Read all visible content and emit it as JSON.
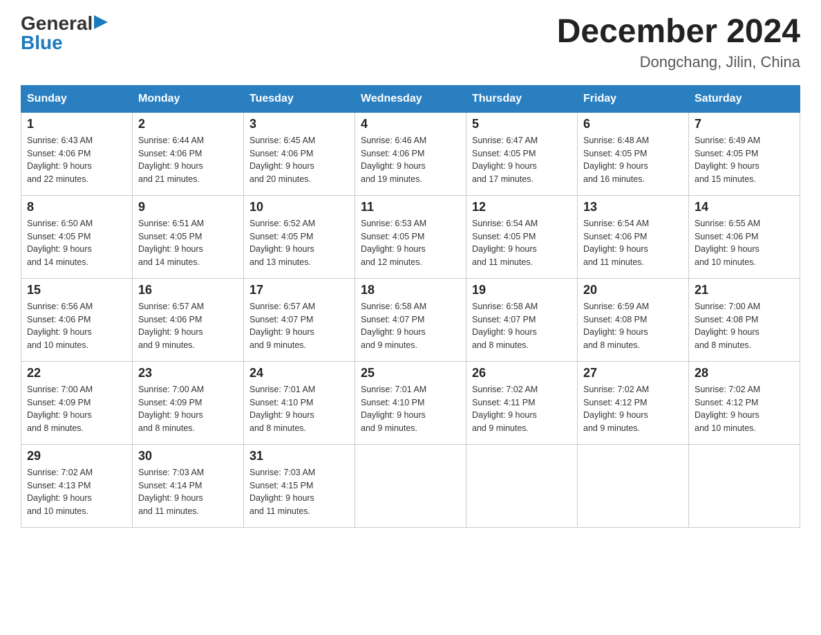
{
  "header": {
    "logo_general": "General",
    "logo_blue": "Blue",
    "title": "December 2024",
    "subtitle": "Dongchang, Jilin, China"
  },
  "days_of_week": [
    "Sunday",
    "Monday",
    "Tuesday",
    "Wednesday",
    "Thursday",
    "Friday",
    "Saturday"
  ],
  "weeks": [
    [
      {
        "day": "1",
        "sunrise": "6:43 AM",
        "sunset": "4:06 PM",
        "daylight": "9 hours and 22 minutes."
      },
      {
        "day": "2",
        "sunrise": "6:44 AM",
        "sunset": "4:06 PM",
        "daylight": "9 hours and 21 minutes."
      },
      {
        "day": "3",
        "sunrise": "6:45 AM",
        "sunset": "4:06 PM",
        "daylight": "9 hours and 20 minutes."
      },
      {
        "day": "4",
        "sunrise": "6:46 AM",
        "sunset": "4:06 PM",
        "daylight": "9 hours and 19 minutes."
      },
      {
        "day": "5",
        "sunrise": "6:47 AM",
        "sunset": "4:05 PM",
        "daylight": "9 hours and 17 minutes."
      },
      {
        "day": "6",
        "sunrise": "6:48 AM",
        "sunset": "4:05 PM",
        "daylight": "9 hours and 16 minutes."
      },
      {
        "day": "7",
        "sunrise": "6:49 AM",
        "sunset": "4:05 PM",
        "daylight": "9 hours and 15 minutes."
      }
    ],
    [
      {
        "day": "8",
        "sunrise": "6:50 AM",
        "sunset": "4:05 PM",
        "daylight": "9 hours and 14 minutes."
      },
      {
        "day": "9",
        "sunrise": "6:51 AM",
        "sunset": "4:05 PM",
        "daylight": "9 hours and 14 minutes."
      },
      {
        "day": "10",
        "sunrise": "6:52 AM",
        "sunset": "4:05 PM",
        "daylight": "9 hours and 13 minutes."
      },
      {
        "day": "11",
        "sunrise": "6:53 AM",
        "sunset": "4:05 PM",
        "daylight": "9 hours and 12 minutes."
      },
      {
        "day": "12",
        "sunrise": "6:54 AM",
        "sunset": "4:05 PM",
        "daylight": "9 hours and 11 minutes."
      },
      {
        "day": "13",
        "sunrise": "6:54 AM",
        "sunset": "4:06 PM",
        "daylight": "9 hours and 11 minutes."
      },
      {
        "day": "14",
        "sunrise": "6:55 AM",
        "sunset": "4:06 PM",
        "daylight": "9 hours and 10 minutes."
      }
    ],
    [
      {
        "day": "15",
        "sunrise": "6:56 AM",
        "sunset": "4:06 PM",
        "daylight": "9 hours and 10 minutes."
      },
      {
        "day": "16",
        "sunrise": "6:57 AM",
        "sunset": "4:06 PM",
        "daylight": "9 hours and 9 minutes."
      },
      {
        "day": "17",
        "sunrise": "6:57 AM",
        "sunset": "4:07 PM",
        "daylight": "9 hours and 9 minutes."
      },
      {
        "day": "18",
        "sunrise": "6:58 AM",
        "sunset": "4:07 PM",
        "daylight": "9 hours and 9 minutes."
      },
      {
        "day": "19",
        "sunrise": "6:58 AM",
        "sunset": "4:07 PM",
        "daylight": "9 hours and 8 minutes."
      },
      {
        "day": "20",
        "sunrise": "6:59 AM",
        "sunset": "4:08 PM",
        "daylight": "9 hours and 8 minutes."
      },
      {
        "day": "21",
        "sunrise": "7:00 AM",
        "sunset": "4:08 PM",
        "daylight": "9 hours and 8 minutes."
      }
    ],
    [
      {
        "day": "22",
        "sunrise": "7:00 AM",
        "sunset": "4:09 PM",
        "daylight": "9 hours and 8 minutes."
      },
      {
        "day": "23",
        "sunrise": "7:00 AM",
        "sunset": "4:09 PM",
        "daylight": "9 hours and 8 minutes."
      },
      {
        "day": "24",
        "sunrise": "7:01 AM",
        "sunset": "4:10 PM",
        "daylight": "9 hours and 8 minutes."
      },
      {
        "day": "25",
        "sunrise": "7:01 AM",
        "sunset": "4:10 PM",
        "daylight": "9 hours and 9 minutes."
      },
      {
        "day": "26",
        "sunrise": "7:02 AM",
        "sunset": "4:11 PM",
        "daylight": "9 hours and 9 minutes."
      },
      {
        "day": "27",
        "sunrise": "7:02 AM",
        "sunset": "4:12 PM",
        "daylight": "9 hours and 9 minutes."
      },
      {
        "day": "28",
        "sunrise": "7:02 AM",
        "sunset": "4:12 PM",
        "daylight": "9 hours and 10 minutes."
      }
    ],
    [
      {
        "day": "29",
        "sunrise": "7:02 AM",
        "sunset": "4:13 PM",
        "daylight": "9 hours and 10 minutes."
      },
      {
        "day": "30",
        "sunrise": "7:03 AM",
        "sunset": "4:14 PM",
        "daylight": "9 hours and 11 minutes."
      },
      {
        "day": "31",
        "sunrise": "7:03 AM",
        "sunset": "4:15 PM",
        "daylight": "9 hours and 11 minutes."
      },
      null,
      null,
      null,
      null
    ]
  ]
}
